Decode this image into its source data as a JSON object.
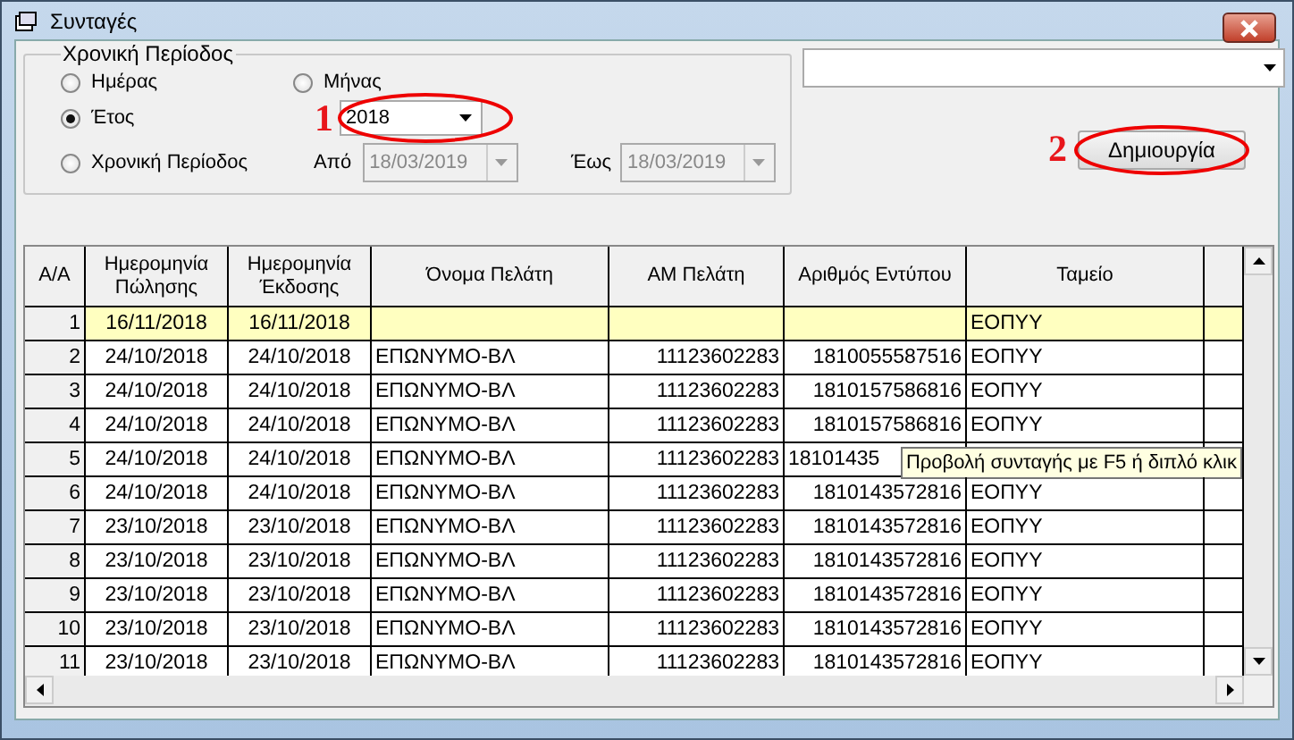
{
  "window": {
    "title": "Συνταγές"
  },
  "period_group": {
    "legend": "Χρονική Περίοδος",
    "options": [
      {
        "label": "Ημέρας",
        "selected": false
      },
      {
        "label": "Μήνας",
        "selected": false
      },
      {
        "label": "Έτος",
        "selected": true
      },
      {
        "label": "Χρονική Περίοδος",
        "selected": false
      }
    ],
    "year": {
      "value": "2018",
      "annotation": "1"
    },
    "from": {
      "label": "Από",
      "value": "18/03/2019",
      "disabled": true
    },
    "to": {
      "label": "Έως",
      "value": "18/03/2019",
      "disabled": true
    }
  },
  "create_button": {
    "label": "Δημιουργία",
    "annotation": "2"
  },
  "table": {
    "columns": [
      "Α/Α",
      "Ημερομηνία Πώλησης",
      "Ημερομηνία Έκδοσης",
      "Όνομα Πελάτη",
      "ΑΜ Πελάτη",
      "Αριθμός Εντύπου",
      "Ταμείο"
    ],
    "rows": [
      {
        "cells": [
          "1",
          "16/11/2018",
          "16/11/2018",
          "",
          "",
          "",
          "ΕΟΠΥΥ"
        ],
        "selected": true
      },
      {
        "cells": [
          "2",
          "24/10/2018",
          "24/10/2018",
          "ΕΠΩΝΥΜΟ-ΒΛ",
          "11123602283",
          "1810055587516",
          "ΕΟΠΥΥ"
        ],
        "selected": false
      },
      {
        "cells": [
          "3",
          "24/10/2018",
          "24/10/2018",
          "ΕΠΩΝΥΜΟ-ΒΛ",
          "11123602283",
          "1810157586816",
          "ΕΟΠΥΥ"
        ],
        "selected": false
      },
      {
        "cells": [
          "4",
          "24/10/2018",
          "24/10/2018",
          "ΕΠΩΝΥΜΟ-ΒΛ",
          "11123602283",
          "1810157586816",
          "ΕΟΠΥΥ"
        ],
        "selected": false
      },
      {
        "cells": [
          "5",
          "24/10/2018",
          "24/10/2018",
          "ΕΠΩΝΥΜΟ-ΒΛ",
          "11123602283",
          "18101435"
        ],
        "selected": false,
        "tooltip": "Προβολή συνταγής με F5 ή διπλό κλικ"
      },
      {
        "cells": [
          "6",
          "24/10/2018",
          "24/10/2018",
          "ΕΠΩΝΥΜΟ-ΒΛ",
          "11123602283",
          "1810143572816",
          "ΕΟΠΥΥ"
        ],
        "selected": false
      },
      {
        "cells": [
          "7",
          "23/10/2018",
          "23/10/2018",
          "ΕΠΩΝΥΜΟ-ΒΛ",
          "11123602283",
          "1810143572816",
          "ΕΟΠΥΥ"
        ],
        "selected": false
      },
      {
        "cells": [
          "8",
          "23/10/2018",
          "23/10/2018",
          "ΕΠΩΝΥΜΟ-ΒΛ",
          "11123602283",
          "1810143572816",
          "ΕΟΠΥΥ"
        ],
        "selected": false
      },
      {
        "cells": [
          "9",
          "23/10/2018",
          "23/10/2018",
          "ΕΠΩΝΥΜΟ-ΒΛ",
          "11123602283",
          "1810143572816",
          "ΕΟΠΥΥ"
        ],
        "selected": false
      },
      {
        "cells": [
          "10",
          "23/10/2018",
          "23/10/2018",
          "ΕΠΩΝΥΜΟ-ΒΛ",
          "11123602283",
          "1810143572816",
          "ΕΟΠΥΥ"
        ],
        "selected": false
      },
      {
        "cells": [
          "11",
          "23/10/2018",
          "23/10/2018",
          "ΕΠΩΝΥΜΟ-ΒΛ",
          "11123602283",
          "1810143572816",
          "ΕΟΠΥΥ"
        ],
        "selected": false
      }
    ]
  }
}
